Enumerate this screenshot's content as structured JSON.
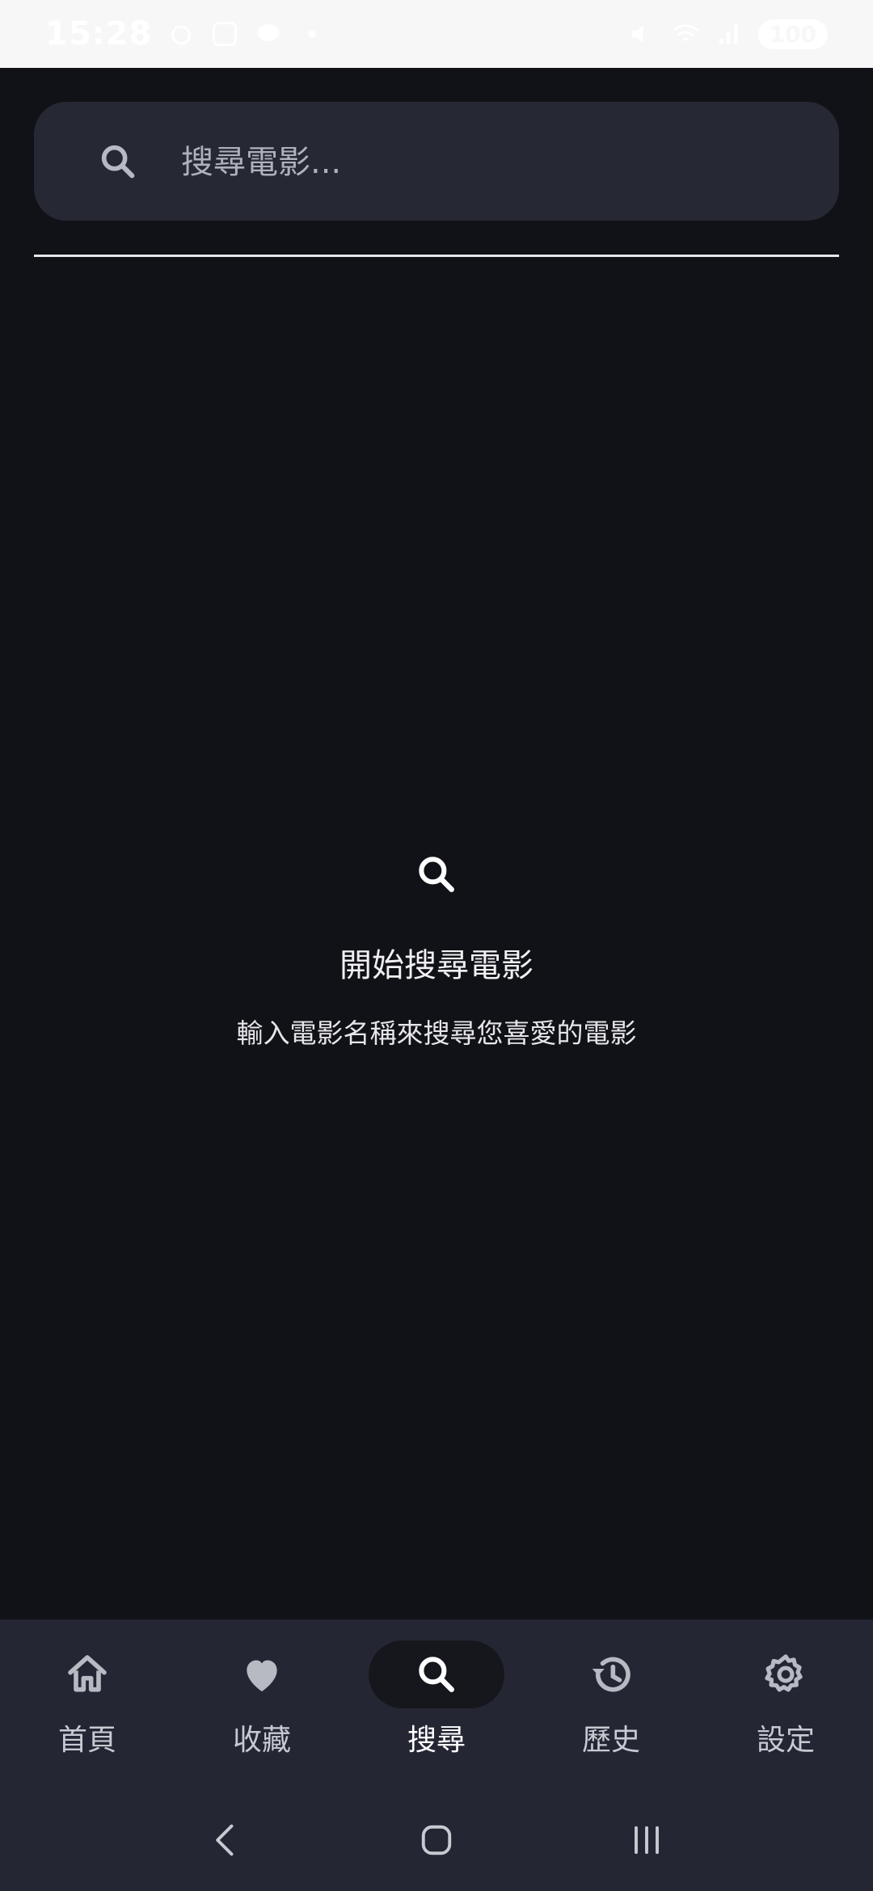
{
  "status_bar": {
    "time": "15:28",
    "battery": "100"
  },
  "search": {
    "placeholder": "搜尋電影..."
  },
  "empty_state": {
    "title": "開始搜尋電影",
    "subtitle": "輸入電影名稱來搜尋您喜愛的電影"
  },
  "nav": {
    "items": [
      {
        "label": "首頁",
        "icon": "home-icon"
      },
      {
        "label": "收藏",
        "icon": "heart-icon"
      },
      {
        "label": "搜尋",
        "icon": "search-icon",
        "active": true
      },
      {
        "label": "歷史",
        "icon": "history-icon"
      },
      {
        "label": "設定",
        "icon": "gear-icon"
      }
    ]
  },
  "colors": {
    "background": "#111217",
    "search_bar": "#262834",
    "bottom_nav": "#242634",
    "active_pill": "#16171d",
    "icon_gray": "#b7bac3"
  }
}
